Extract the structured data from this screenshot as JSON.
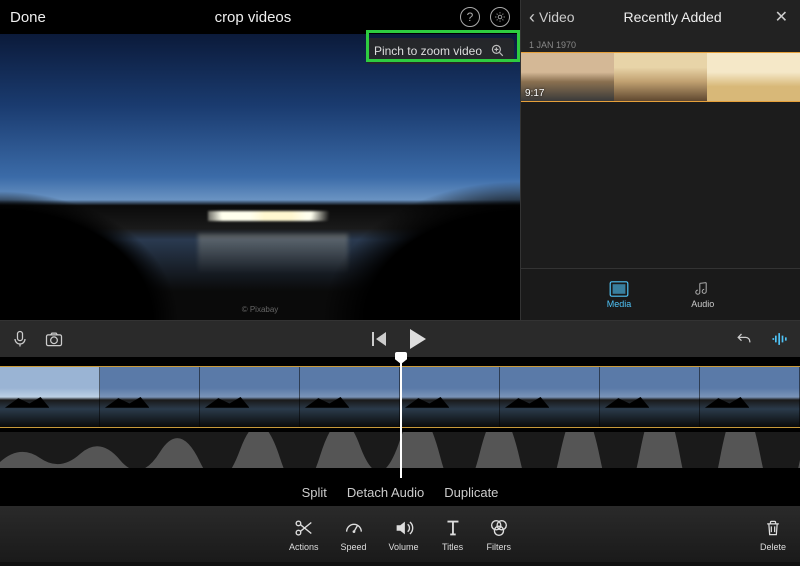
{
  "header": {
    "done": "Done",
    "project_title": "crop videos"
  },
  "zoom_hint": "Pinch to zoom video",
  "media_panel": {
    "back_label": "Video",
    "title": "Recently Added",
    "date": "1 JAN 1970",
    "clip_duration": "9:17",
    "tabs": {
      "media": "Media",
      "audio": "Audio"
    }
  },
  "action_labels": {
    "split": "Split",
    "detach_audio": "Detach Audio",
    "duplicate": "Duplicate"
  },
  "tools": {
    "actions": "Actions",
    "speed": "Speed",
    "volume": "Volume",
    "titles": "Titles",
    "filters": "Filters",
    "delete": "Delete"
  },
  "colors": {
    "highlight": "#2ecc40",
    "accent_media": "#4fc3f7",
    "clip_border": "#c99a3a"
  }
}
